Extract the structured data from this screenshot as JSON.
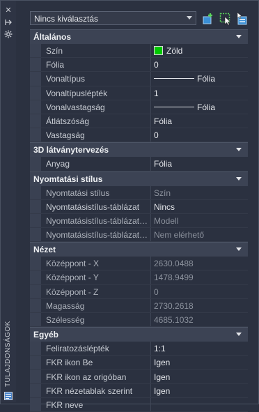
{
  "panel": {
    "title": "TULAJDONSÁGOK"
  },
  "selector": {
    "value": "Nincs kiválasztás"
  },
  "toolbar": {
    "quick_select": "quick-select-icon",
    "select_objects": "select-objects-icon",
    "toggle_pickadd": "toggle-pickadd-icon"
  },
  "sections": {
    "general": {
      "title": "Általános",
      "rows": [
        {
          "label": "Szín",
          "value": "Zöld",
          "color": "#00c800"
        },
        {
          "label": "Fólia",
          "value": "0"
        },
        {
          "label": "Vonaltípus",
          "value": "Fólia"
        },
        {
          "label": "Vonaltípuslépték",
          "value": "1"
        },
        {
          "label": "Vonalvastagság",
          "value": "Fólia"
        },
        {
          "label": "Átlátszóság",
          "value": "Fólia"
        },
        {
          "label": "Vastagság",
          "value": "0"
        }
      ]
    },
    "visual3d": {
      "title": "3D látványtervezés",
      "rows": [
        {
          "label": "Anyag",
          "value": "Fólia"
        }
      ]
    },
    "plotstyle": {
      "title": "Nyomtatási stílus",
      "rows": [
        {
          "label": "Nyomtatási stílus",
          "value": "Szín"
        },
        {
          "label": "Nyomtatásistílus-táblázat",
          "value": "Nincs"
        },
        {
          "label": "Nyomtatásistílus-táblázat…",
          "value": "Modell"
        },
        {
          "label": "Nyomtatásistílus-táblázat…",
          "value": "Nem elérhető"
        }
      ]
    },
    "view": {
      "title": "Nézet",
      "rows": [
        {
          "label": "Középpont - X",
          "value": "2630.0488"
        },
        {
          "label": "Középpont - Y",
          "value": "1478.9499"
        },
        {
          "label": "Középpont - Z",
          "value": "0"
        },
        {
          "label": "Magasság",
          "value": "2730.2618"
        },
        {
          "label": "Szélesség",
          "value": "4685.1032"
        }
      ]
    },
    "misc": {
      "title": "Egyéb",
      "rows": [
        {
          "label": "Feliratozáslépték",
          "value": "1:1"
        },
        {
          "label": "FKR ikon Be",
          "value": "Igen"
        },
        {
          "label": "FKR ikon az origóban",
          "value": "Igen"
        },
        {
          "label": "FKR nézetablak szerint",
          "value": "Igen"
        },
        {
          "label": "FKR neve",
          "value": ""
        }
      ]
    }
  }
}
